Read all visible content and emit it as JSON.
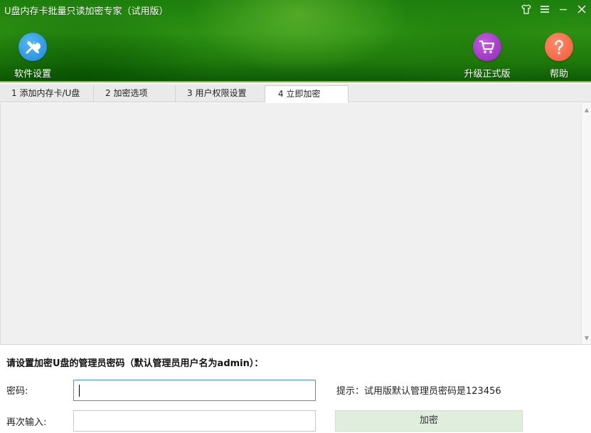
{
  "window": {
    "title": "U盘内存卡批量只读加密专家（试用版）",
    "controls": {
      "skin_icon": "shirt-icon",
      "menu_icon": "menu-icon",
      "minimize_icon": "minimize-icon",
      "close_icon": "close-icon"
    }
  },
  "toolbar": {
    "settings": {
      "label": "软件设置",
      "icon": "wrench-screwdriver-icon",
      "color": "#1f86d6"
    },
    "upgrade": {
      "label": "升级正式版",
      "icon": "shopping-cart-icon",
      "color": "#8e27b8"
    },
    "help": {
      "label": "帮助",
      "icon": "question-mark-icon",
      "color": "#ef5a3a"
    }
  },
  "tabs": [
    {
      "label": "1 添加内存卡/U盘",
      "active": false
    },
    {
      "label": "2 加密选项",
      "active": false
    },
    {
      "label": "3 用户权限设置",
      "active": false
    },
    {
      "label": "4 立即加密",
      "active": true
    }
  ],
  "form": {
    "heading": "请设置加密U盘的管理员密码（默认管理员用户名为admin）：",
    "password_label": "密码:",
    "password_value": "",
    "repeat_label": "再次输入:",
    "repeat_value": "",
    "hint": "提示：试用版默认管理员密码是123456",
    "encrypt_label": "加密"
  },
  "colors": {
    "header_green": "#1f7a0b",
    "accent_blue": "#4a90d9",
    "encrypt_button": "#dfeedd"
  }
}
